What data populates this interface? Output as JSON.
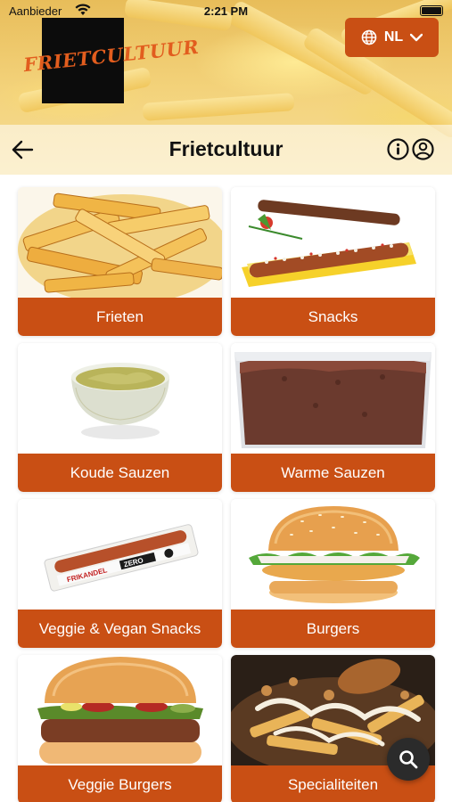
{
  "status_bar": {
    "carrier": "Aanbieder",
    "time": "2:21 PM"
  },
  "header": {
    "logo_text": "FRIETCULTUUR",
    "language_label": "NL",
    "title": "Frietcultuur"
  },
  "colors": {
    "accent": "#c94f14",
    "fab": "#2b2b2b"
  },
  "icons": {
    "back": "arrow-left-icon",
    "info": "info-icon",
    "account": "account-icon",
    "language": "globe-icon",
    "dropdown": "chevron-down-icon",
    "search": "search-icon"
  },
  "categories": [
    {
      "label": "Frieten",
      "image": "fries"
    },
    {
      "label": "Snacks",
      "image": "snacks"
    },
    {
      "label": "Koude Sauzen",
      "image": "cold-sauce"
    },
    {
      "label": "Warme Sauzen",
      "image": "warm-sauce"
    },
    {
      "label": "Veggie & Vegan Snacks",
      "image": "veggie-snack"
    },
    {
      "label": "Burgers",
      "image": "burger"
    },
    {
      "label": "Veggie Burgers",
      "image": "veggie-burger"
    },
    {
      "label": "Specialiteiten",
      "image": "specialties"
    }
  ],
  "product_text": {
    "frikandel_brand": "FRIKANDEL",
    "frikandel_zero": "ZERO"
  }
}
